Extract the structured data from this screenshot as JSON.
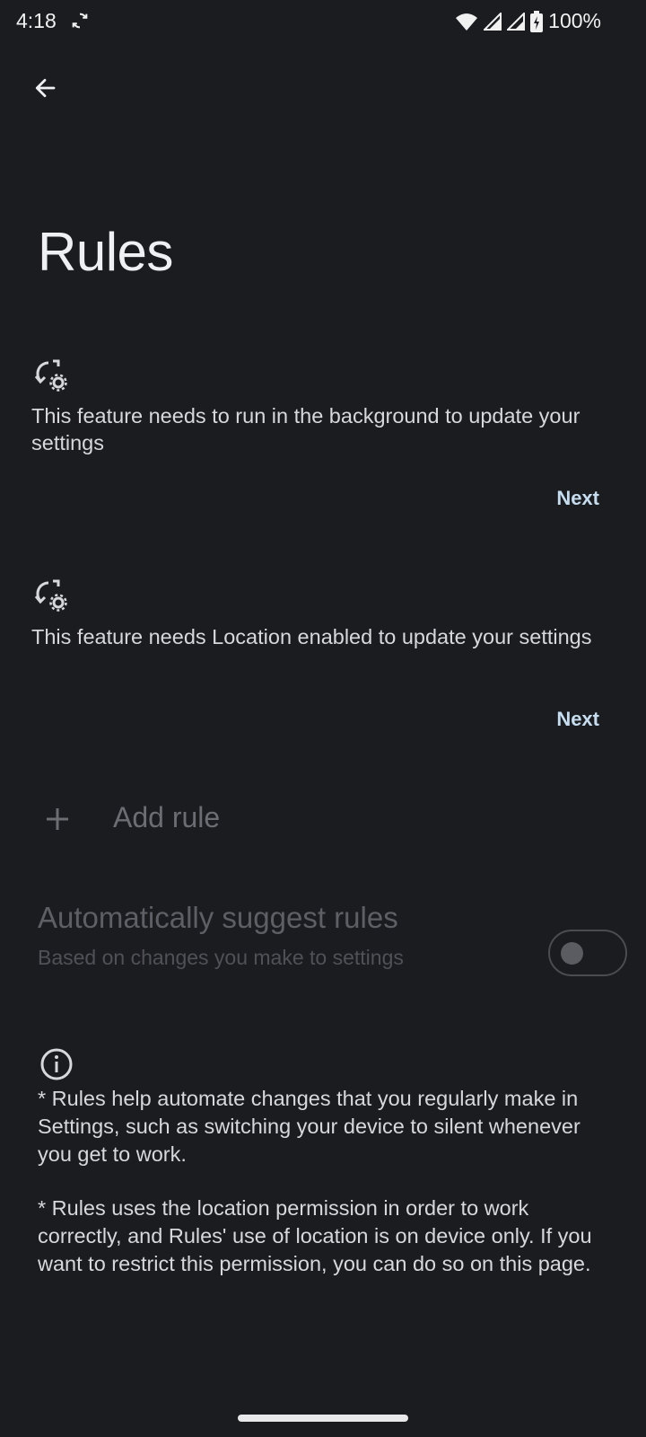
{
  "status_bar": {
    "time": "4:18",
    "battery": "100%"
  },
  "page": {
    "title": "Rules"
  },
  "cards": [
    {
      "text": "This feature needs to run in the background to update your settings",
      "action": "Next"
    },
    {
      "text": "This feature needs Location enabled to update your settings",
      "action": "Next"
    }
  ],
  "add_rule": {
    "label": "Add rule"
  },
  "suggest": {
    "title": "Automatically suggest rules",
    "subtitle": "Based on changes you make to settings",
    "enabled": false
  },
  "info": {
    "paragraphs": [
      "* Rules help automate changes that you regularly make in Settings, such as switching your device to silent whenever you get to work.",
      "* Rules uses the location permission in order to work correctly, and Rules' use of location is on device only. If you want to restrict this permission, you can do so on this page."
    ]
  }
}
